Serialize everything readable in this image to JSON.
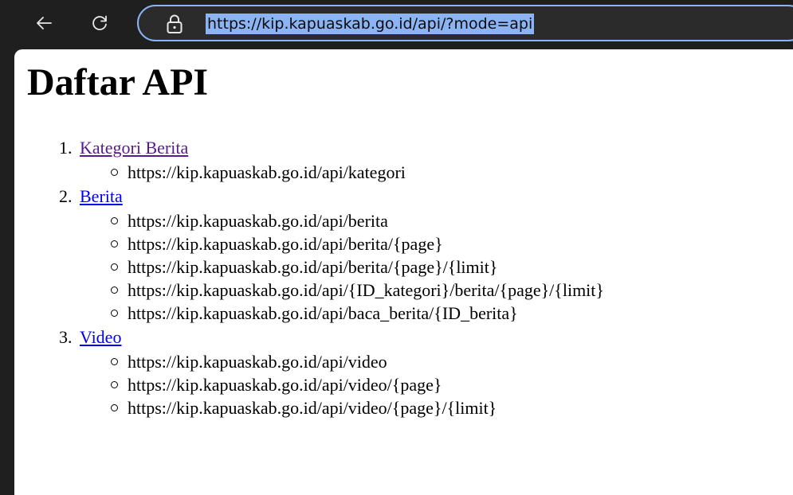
{
  "browser": {
    "url": "https://kip.kapuaskab.go.id/api/?mode=api",
    "back_icon": "arrow-left-icon",
    "reload_icon": "reload-icon",
    "lock_icon": "lock-icon"
  },
  "page": {
    "title": "Daftar API",
    "items": [
      {
        "number": "1.",
        "label": "Kategori Berita",
        "visited": true,
        "endpoints": [
          "https://kip.kapuaskab.go.id/api/kategori"
        ]
      },
      {
        "number": "2.",
        "label": "Berita",
        "visited": false,
        "endpoints": [
          "https://kip.kapuaskab.go.id/api/berita",
          "https://kip.kapuaskab.go.id/api/berita/{page}",
          "https://kip.kapuaskab.go.id/api/berita/{page}/{limit}",
          "https://kip.kapuaskab.go.id/api/{ID_kategori}/berita/{page}/{limit}",
          "https://kip.kapuaskab.go.id/api/baca_berita/{ID_berita}"
        ]
      },
      {
        "number": "3.",
        "label": "Video",
        "visited": false,
        "endpoints": [
          "https://kip.kapuaskab.go.id/api/video",
          "https://kip.kapuaskab.go.id/api/video/{page}",
          "https://kip.kapuaskab.go.id/api/video/{page}/{limit}"
        ]
      }
    ]
  },
  "colors": {
    "link": "#0000ee",
    "visited_link": "#551a8b",
    "url_highlight": "#8cb4f4",
    "toolbar": "#1f1f1f",
    "address_border": "#8ab4f8"
  }
}
